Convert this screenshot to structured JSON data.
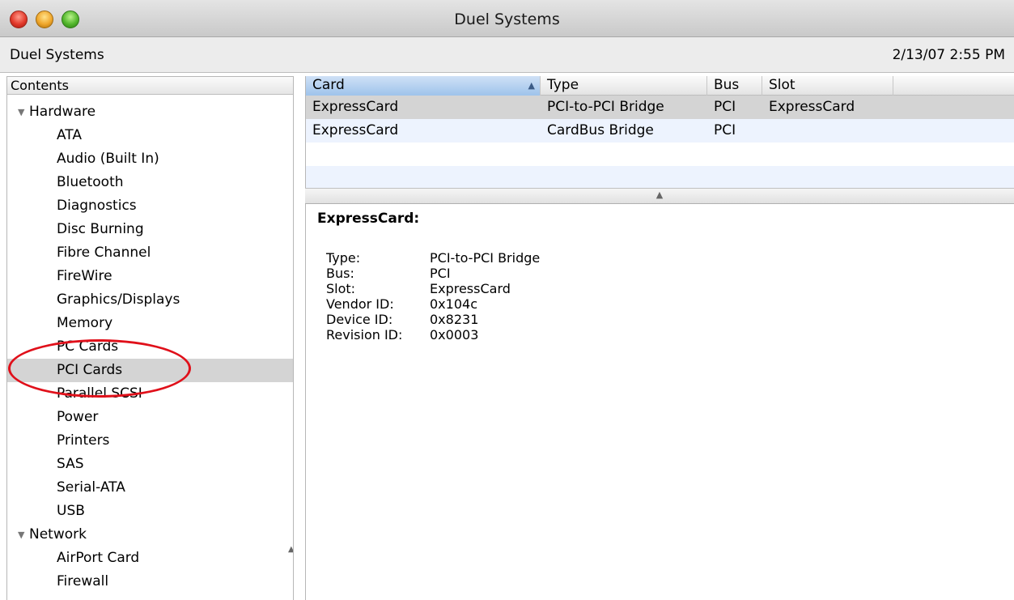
{
  "window": {
    "title": "Duel Systems"
  },
  "infobar": {
    "computer_name": "Duel Systems",
    "timestamp": "2/13/07 2:55 PM"
  },
  "sidebar": {
    "header": "Contents",
    "groups": [
      {
        "label": "Hardware",
        "items": [
          "ATA",
          "Audio (Built In)",
          "Bluetooth",
          "Diagnostics",
          "Disc Burning",
          "Fibre Channel",
          "FireWire",
          "Graphics/Displays",
          "Memory",
          "PC Cards",
          "PCI Cards",
          "Parallel SCSI",
          "Power",
          "Printers",
          "SAS",
          "Serial-ATA",
          "USB"
        ]
      },
      {
        "label": "Network",
        "items": [
          "AirPort Card",
          "Firewall"
        ]
      }
    ],
    "selected_item": "PCI Cards"
  },
  "table": {
    "columns": [
      "Card",
      "Type",
      "Bus",
      "Slot"
    ],
    "sorted_column": "Card",
    "rows": [
      {
        "card": "ExpressCard",
        "type": "PCI-to-PCI Bridge",
        "bus": "PCI",
        "slot": "ExpressCard"
      },
      {
        "card": "ExpressCard",
        "type": "CardBus Bridge",
        "bus": "PCI",
        "slot": ""
      }
    ]
  },
  "detail": {
    "title": "ExpressCard:",
    "properties": [
      {
        "key": "Type:",
        "value": "PCI-to-PCI Bridge"
      },
      {
        "key": "Bus:",
        "value": "PCI"
      },
      {
        "key": "Slot:",
        "value": "ExpressCard"
      },
      {
        "key": "Vendor ID:",
        "value": "0x104c"
      },
      {
        "key": "Device ID:",
        "value": "0x8231"
      },
      {
        "key": "Revision ID:",
        "value": "0x0003"
      }
    ]
  },
  "colors": {
    "annotation": "#e0101a",
    "selection": "#d4d4d4",
    "sorted_header": "#9ec3eb"
  }
}
